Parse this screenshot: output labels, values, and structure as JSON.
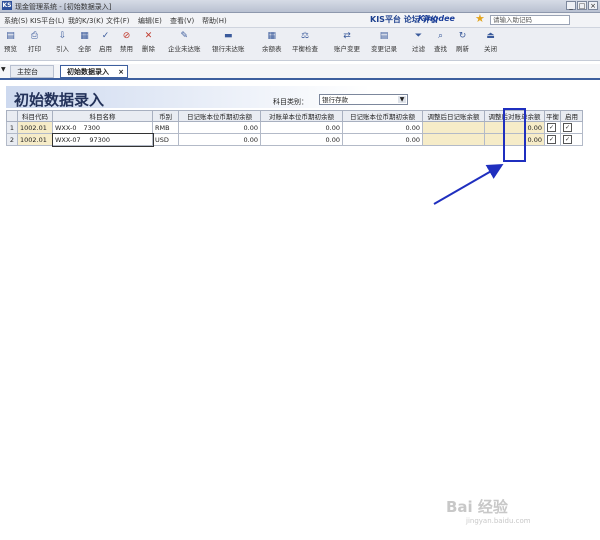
{
  "window": {
    "title": "现金管理系统 - [初始数据录入]",
    "app_icon": "KS"
  },
  "menu": [
    "系统(S)",
    "KIS平台(L)",
    "我的K/3(K)",
    "文件(F)",
    "编辑(E)",
    "查看(V)",
    "帮助(H)"
  ],
  "brand": {
    "links": "KIS平台 论坛 评价",
    "logo": "Kingdee",
    "search_placeholder": "请输入助记码"
  },
  "toolbar": [
    "预览",
    "打印",
    "引入",
    "全部",
    "启用",
    "禁用",
    "删除",
    "企业未达账",
    "银行未达账",
    "余额表",
    "平衡检查",
    "账户变更",
    "变更记录",
    "过滤",
    "查找",
    "刷新",
    "关闭"
  ],
  "tabs": {
    "main": "主控台",
    "active": "初始数据录入"
  },
  "page": {
    "title": "初始数据录入",
    "category_label": "科目类别：",
    "category_value": "银行存款"
  },
  "grid": {
    "headers": [
      "",
      "科目代码",
      "科目名称",
      "币别",
      "日记账本位币期初余额",
      "对账单本位币期初余额",
      "日记账本位币期初余额",
      "调整后日记账余额",
      "调整后对账单余额",
      "平衡",
      "启用"
    ],
    "rows": [
      {
        "num": "1",
        "code": "1002.01",
        "name_a": "WXX-0",
        "name_b": "7300",
        "currency": "RMB",
        "v1": "0.00",
        "v2": "0.00",
        "v3": "0.00",
        "v4": "0.00",
        "balance": "✓",
        "enabled": "✓"
      },
      {
        "num": "2",
        "code": "1002.01",
        "name_a": "WXX-07",
        "name_b": "97300",
        "currency": "USD",
        "v1": "0.00",
        "v2": "0.00",
        "v3": "0.00",
        "v4": "0.00",
        "balance": "✓",
        "enabled": "✓"
      }
    ]
  },
  "watermark": {
    "main": "Bai 经验",
    "sub": "jingyan.baidu.com"
  },
  "colors": {
    "highlight": "#1f2fbf",
    "beige": "#f6ecc8"
  }
}
